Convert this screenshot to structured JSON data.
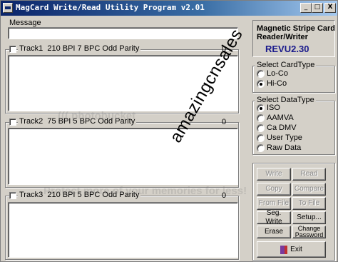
{
  "window": {
    "title": "MagCard Write/Read Utility Program v2.01",
    "controls": {
      "minimize": "_",
      "maximize": "□",
      "close": "X"
    }
  },
  "message": {
    "label": "Message",
    "value": ""
  },
  "tracks": [
    {
      "label": "Track1",
      "format": "210 BPI 7 BPC Odd Parity",
      "count": "0",
      "value": ""
    },
    {
      "label": "Track2",
      "format": "75 BPI 5 BPC Odd Parity",
      "count": "0",
      "value": ""
    },
    {
      "label": "Track3",
      "format": "210 BPI 5 BPC Odd Parity",
      "count": "0",
      "value": ""
    }
  ],
  "brand": {
    "line1": "Magnetic Stripe Card",
    "line2": "Reader/Writer",
    "model": "REVU2.30"
  },
  "card_type": {
    "title": "Select CardType",
    "options": [
      "Lo-Co",
      "Hi-Co"
    ],
    "selected": "Hi-Co"
  },
  "data_type": {
    "title": "Select DataType",
    "options": [
      "ISO",
      "AAMVA",
      "Ca DMV",
      "User Type",
      "Raw Data"
    ],
    "selected": "ISO"
  },
  "buttons": {
    "write": "Write",
    "read": "Read",
    "copy": "Copy",
    "compare": "Compare",
    "from_file": "From File",
    "to_file": "To File",
    "seg_write": "Seg. Write",
    "setup": "Setup...",
    "erase": "Erase",
    "change_password_1": "Change",
    "change_password_2": "Password",
    "exit": "Exit"
  },
  "overlay": {
    "seller": "amazingcnsales",
    "watermark1": "((( photobucket",
    "watermark2": "Protect more of your memories for less!"
  },
  "colors": {
    "titlebar": "#0a246a",
    "face": "#d4d0c8",
    "brand_model": "#1a1a8c"
  }
}
